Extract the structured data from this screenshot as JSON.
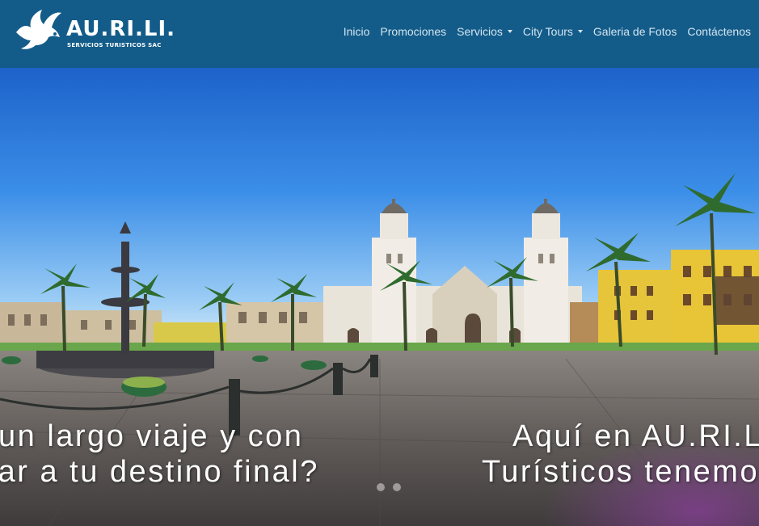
{
  "brand": {
    "name": "AU.RI.LI.",
    "tagline": "SERVICIOS TURISTICOS SAC"
  },
  "nav": {
    "items": [
      {
        "label": "Inicio"
      },
      {
        "label": "Promociones"
      },
      {
        "label": "Servicios"
      },
      {
        "label": "City Tours"
      },
      {
        "label": "Galeria de Fotos"
      },
      {
        "label": "Contáctenos"
      }
    ]
  },
  "hero": {
    "slide_left": {
      "line1": "un largo viaje y con",
      "line2": "gar a tu destino final?"
    },
    "slide_right": {
      "line1": "Aquí en AU.RI.LI",
      "line2": "Turísticos tenemo"
    }
  },
  "colors": {
    "navbar": "#135c89",
    "nav_text": "#d4e4ef"
  }
}
